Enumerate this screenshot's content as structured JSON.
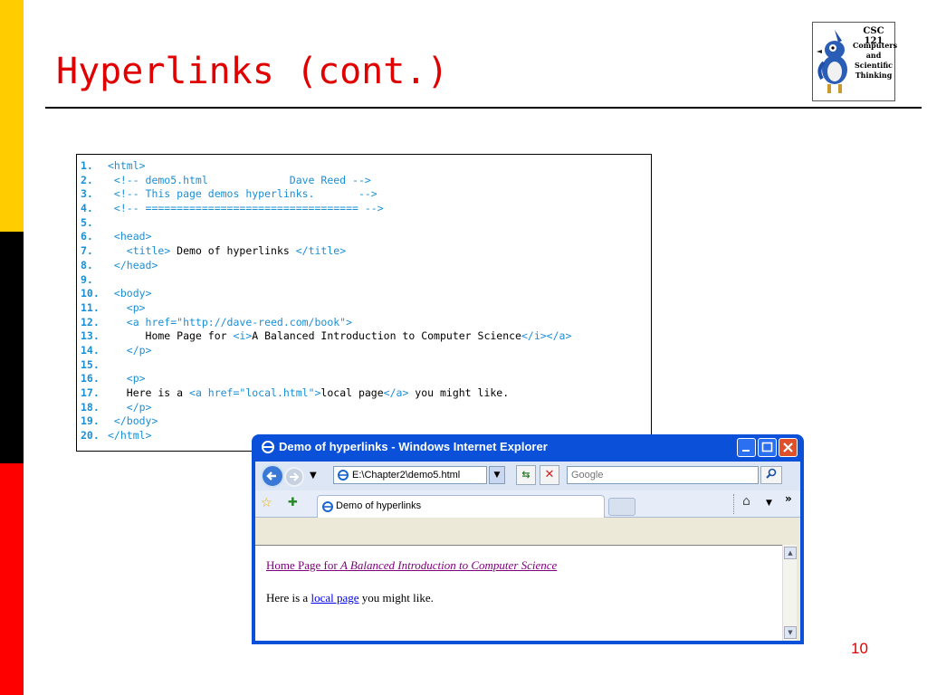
{
  "slide": {
    "title": "Hyperlinks (cont.)",
    "number": "10",
    "colors": {
      "title": "#e00000",
      "bar_yellow": "#ffcc00",
      "bar_black": "#000000",
      "bar_red": "#ff0000"
    }
  },
  "logo": {
    "course": "CSC 121",
    "subtitle": "Computers\nand\nScientific\nThinking"
  },
  "code": {
    "lines": [
      {
        "n": "1.",
        "parts": [
          [
            "tag",
            "<html>"
          ]
        ]
      },
      {
        "n": "2.",
        "parts": [
          [
            "cmt",
            " <!-- demo5.html             Dave Reed -->"
          ]
        ]
      },
      {
        "n": "3.",
        "parts": [
          [
            "cmt",
            " <!-- This page demos hyperlinks.       -->"
          ]
        ]
      },
      {
        "n": "4.",
        "parts": [
          [
            "cmt",
            " <!-- ================================== -->"
          ]
        ]
      },
      {
        "n": "5.",
        "parts": []
      },
      {
        "n": "6.",
        "parts": [
          [
            "tag",
            " <head>"
          ]
        ]
      },
      {
        "n": "7.",
        "parts": [
          [
            "txt",
            "   "
          ],
          [
            "tag",
            "<title>"
          ],
          [
            "txt",
            " Demo of hyperlinks "
          ],
          [
            "tag",
            "</title>"
          ]
        ]
      },
      {
        "n": "8.",
        "parts": [
          [
            "tag",
            " </head>"
          ]
        ]
      },
      {
        "n": "9.",
        "parts": []
      },
      {
        "n": "10.",
        "parts": [
          [
            "tag",
            " <body>"
          ]
        ]
      },
      {
        "n": "11.",
        "parts": [
          [
            "tag",
            "   <p>"
          ]
        ]
      },
      {
        "n": "12.",
        "parts": [
          [
            "tag",
            "   <a href=\"http://dave-reed.com/book\">"
          ]
        ]
      },
      {
        "n": "13.",
        "parts": [
          [
            "txt",
            "      Home Page for "
          ],
          [
            "tag",
            "<i>"
          ],
          [
            "txt",
            "A Balanced Introduction to Computer Science"
          ],
          [
            "tag",
            "</i></a>"
          ]
        ]
      },
      {
        "n": "14.",
        "parts": [
          [
            "tag",
            "   </p>"
          ]
        ]
      },
      {
        "n": "15.",
        "parts": []
      },
      {
        "n": "16.",
        "parts": [
          [
            "tag",
            "   <p>"
          ]
        ]
      },
      {
        "n": "17.",
        "parts": [
          [
            "txt",
            "   Here is a "
          ],
          [
            "tag",
            "<a href=\"local.html\">"
          ],
          [
            "txt",
            "local page"
          ],
          [
            "tag",
            "</a>"
          ],
          [
            "txt",
            " you might like."
          ]
        ]
      },
      {
        "n": "18.",
        "parts": [
          [
            "tag",
            "   </p>"
          ]
        ]
      },
      {
        "n": "19.",
        "parts": [
          [
            "tag",
            " </body>"
          ]
        ]
      },
      {
        "n": "20.",
        "parts": [
          [
            "tag",
            "</html>"
          ]
        ]
      }
    ]
  },
  "browser": {
    "window_title": "Demo of hyperlinks - Windows Internet Explorer",
    "address": "E:\\Chapter2\\demo5.html",
    "search_placeholder": "Google",
    "tab_label": "Demo of hyperlinks",
    "chevron": "»",
    "page": {
      "link1_prefix": "Home Page for ",
      "link1_italic": "A Balanced Introduction to Computer Science",
      "para2_before": "Here is a ",
      "link2": "local page",
      "para2_after": " you might like."
    },
    "colors": {
      "frame": "#0a50d9",
      "visited_link": "#800080",
      "link": "#0000ee"
    }
  }
}
